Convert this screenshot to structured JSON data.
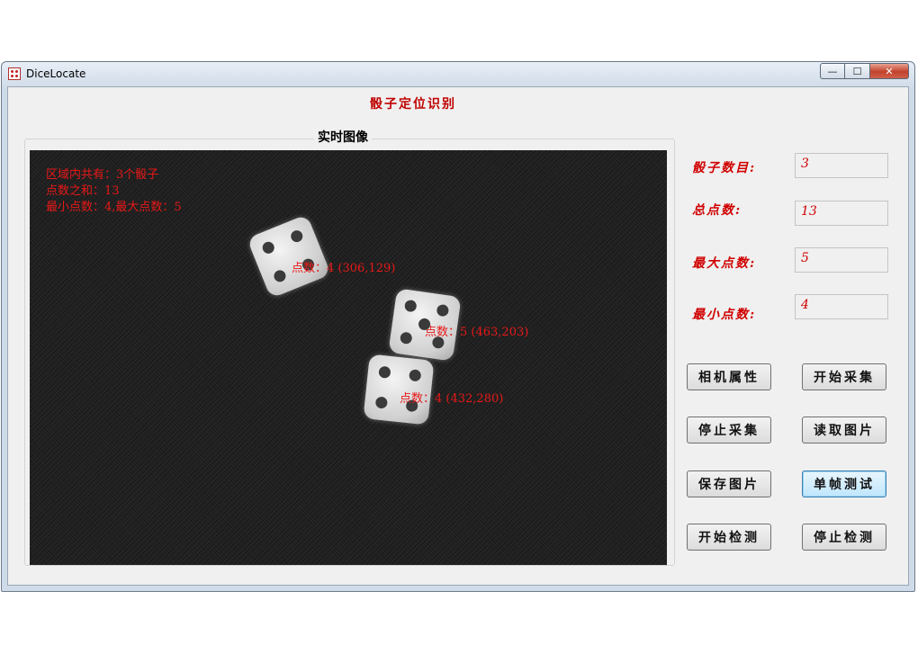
{
  "window": {
    "title": "DiceLocate",
    "controls": {
      "minimize": "—",
      "maximize": "☐",
      "close": "✕"
    }
  },
  "app": {
    "title": "骰子定位识别"
  },
  "image_panel": {
    "title": "实时图像",
    "overlay": {
      "line1": "区域内共有：3个骰子",
      "line2": "点数之和：13",
      "line3": "最小点数：4,最大点数：5"
    },
    "dice": [
      {
        "pips": 4,
        "label": "点数：4 (306,129)"
      },
      {
        "pips": 5,
        "label": "点数：5 (463,203)"
      },
      {
        "pips": 4,
        "label": "点数：4 (432,280)"
      }
    ]
  },
  "stats": {
    "count_label": "骰子数目:",
    "count_value": "3",
    "total_label": "总点数:",
    "total_value": "13",
    "max_label": "最大点数:",
    "max_value": "5",
    "min_label": "最小点数:",
    "min_value": "4"
  },
  "buttons": {
    "camera_props": "相机属性",
    "start_capture": "开始采集",
    "stop_capture": "停止采集",
    "read_image": "读取图片",
    "save_image": "保存图片",
    "single_test": "单帧测试",
    "start_detect": "开始检测",
    "stop_detect": "停止检测"
  },
  "colors": {
    "accent_red": "#d00000",
    "overlay_red": "#e81818",
    "image_bg": "#202020"
  }
}
